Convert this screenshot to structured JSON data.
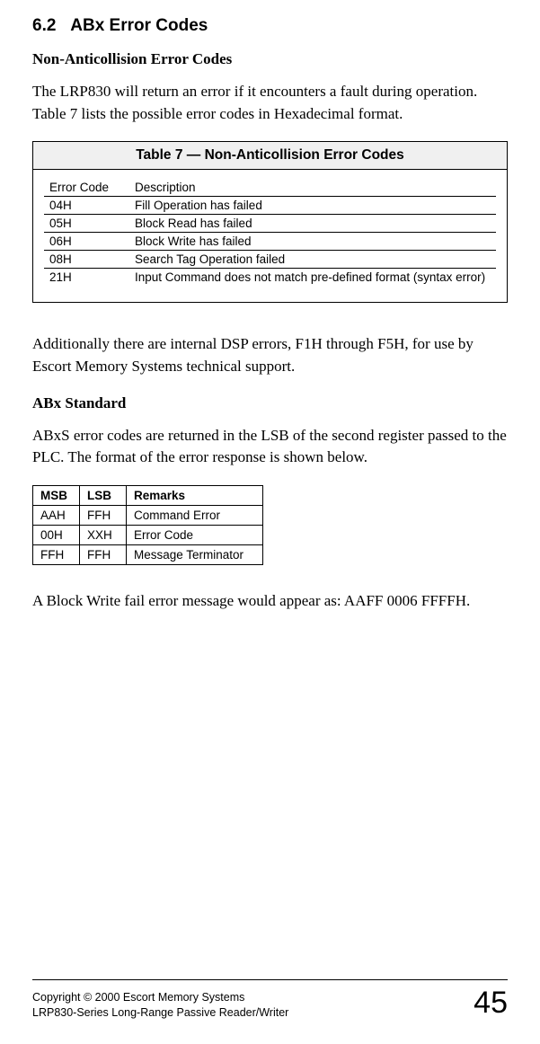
{
  "section": {
    "number": "6.2",
    "title": "ABx Error Codes"
  },
  "nonAnticollision": {
    "heading": "Non-Anticollision Error Codes",
    "intro": "The LRP830 will return an error if it encounters a fault during operation. Table 7 lists the possible error codes in Hexadecimal format.",
    "tableTitle": "Table 7 — Non-Anticollision Error Codes",
    "headers": {
      "code": "Error Code",
      "desc": "Description"
    },
    "rows": [
      {
        "code": "04H",
        "desc": "Fill Operation has failed"
      },
      {
        "code": "05H",
        "desc": "Block Read has failed"
      },
      {
        "code": "06H",
        "desc": "Block Write has failed"
      },
      {
        "code": "08H",
        "desc": "Search Tag Operation failed"
      },
      {
        "code": "21H",
        "desc": "Input Command does not match pre-defined format (syntax error)"
      }
    ],
    "note": "Additionally there are internal DSP errors, F1H through F5H, for use by Escort Memory Systems technical support."
  },
  "abxStandard": {
    "heading": "ABx Standard",
    "intro": "ABxS error codes are returned in the LSB of the second register passed to the PLC.  The format of the error response is shown below.",
    "headers": {
      "msb": "MSB",
      "lsb": "LSB",
      "remarks": "Remarks"
    },
    "rows": [
      {
        "msb": "AAH",
        "lsb": "FFH",
        "remarks": "Command Error"
      },
      {
        "msb": "00H",
        "lsb": "XXH",
        "remarks": "Error Code"
      },
      {
        "msb": "FFH",
        "lsb": "FFH",
        "remarks": "Message Terminator"
      }
    ],
    "example": "A Block Write fail error message would appear as: AAFF 0006 FFFFH."
  },
  "footer": {
    "copyright": "Copyright © 2000 Escort Memory Systems",
    "product": "LRP830-Series Long-Range Passive Reader/Writer",
    "page": "45"
  }
}
